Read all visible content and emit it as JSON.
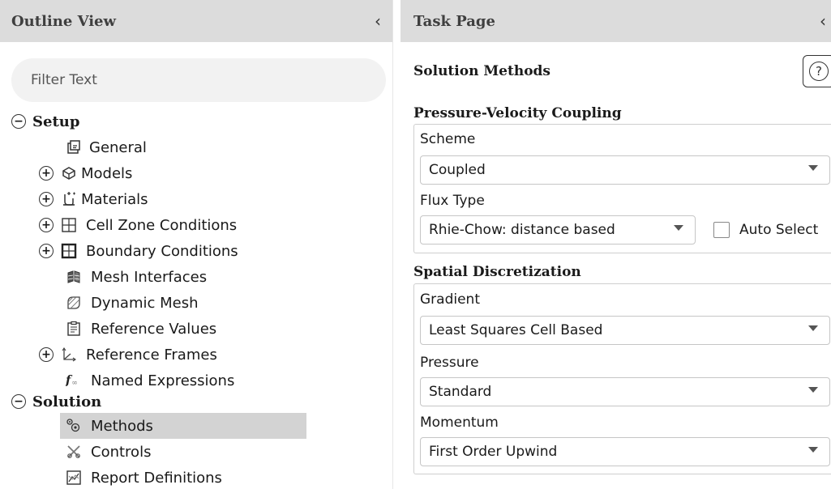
{
  "outline": {
    "title": "Outline View",
    "collapse_glyph": "‹",
    "filter_placeholder": "Filter Text",
    "tree": {
      "setup": {
        "label": "Setup",
        "toggle": "−"
      },
      "general": {
        "label": "General",
        "icon": "general-icon"
      },
      "models": {
        "label": "Models",
        "icon": "models-icon",
        "toggle": "+"
      },
      "materials": {
        "label": "Materials",
        "icon": "materials-icon",
        "toggle": "+"
      },
      "cell_zone": {
        "label": "Cell Zone Conditions",
        "icon": "cell-zone-icon",
        "toggle": "+"
      },
      "boundary": {
        "label": "Boundary Conditions",
        "icon": "boundary-icon",
        "toggle": "+"
      },
      "mesh_interfaces": {
        "label": "Mesh Interfaces",
        "icon": "mesh-interfaces-icon"
      },
      "dynamic_mesh": {
        "label": "Dynamic Mesh",
        "icon": "dynamic-mesh-icon"
      },
      "reference_values": {
        "label": "Reference Values",
        "icon": "reference-values-icon"
      },
      "reference_frames": {
        "label": "Reference Frames",
        "icon": "reference-frames-icon",
        "toggle": "+"
      },
      "named_expressions": {
        "label": "Named Expressions",
        "icon": "function-icon"
      },
      "solution": {
        "label": "Solution",
        "toggle": "−"
      },
      "methods": {
        "label": "Methods",
        "icon": "methods-icon",
        "selected": true
      },
      "controls": {
        "label": "Controls",
        "icon": "controls-icon"
      },
      "report_definitions": {
        "label": "Report Definitions",
        "icon": "report-definitions-icon"
      }
    }
  },
  "task": {
    "title": "Task Page",
    "collapse_glyph": "‹",
    "heading": "Solution Methods",
    "help_glyph": "?",
    "pv_coupling": {
      "title": "Pressure-Velocity Coupling",
      "scheme_label": "Scheme",
      "scheme_value": "Coupled",
      "flux_label": "Flux Type",
      "flux_value": "Rhie-Chow: distance based",
      "auto_select_label": "Auto Select",
      "auto_select_checked": false
    },
    "spatial": {
      "title": "Spatial Discretization",
      "gradient_label": "Gradient",
      "gradient_value": "Least Squares Cell Based",
      "pressure_label": "Pressure",
      "pressure_value": "Standard",
      "momentum_label": "Momentum",
      "momentum_value": "First Order Upwind"
    }
  },
  "colors": {
    "header_bg": "#dcdcdc",
    "selected_bg": "#d3d3d3",
    "filter_bg": "#f2f2f2",
    "border": "#c6c6c6"
  }
}
